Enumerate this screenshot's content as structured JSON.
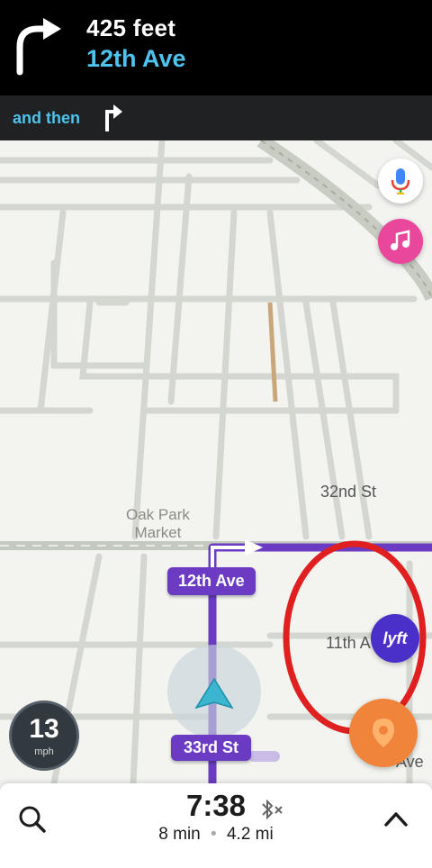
{
  "instruction": {
    "distance": "425 feet",
    "street": "12th Ave",
    "then_label": "and then"
  },
  "map": {
    "labels": {
      "street_32nd": "32nd St",
      "poi_line1": "Oak Park",
      "poi_line2": "Market",
      "street_11th": "11th A",
      "street_ave_partial": "Ave"
    },
    "route_pills": {
      "current_turn": "12th Ave",
      "current_street": "33rd St"
    },
    "buttons": {
      "voice": "microphone-icon",
      "music": "music-note-icon",
      "lyft": "lyft",
      "report": "report-icon"
    },
    "route_color": "#6b3bc4",
    "annotation_color": "#e02020"
  },
  "speedometer": {
    "value": "13",
    "unit": "mph"
  },
  "eta": {
    "time": "7:38",
    "duration": "8 min",
    "distance": "4.2 mi",
    "separator": "•"
  }
}
